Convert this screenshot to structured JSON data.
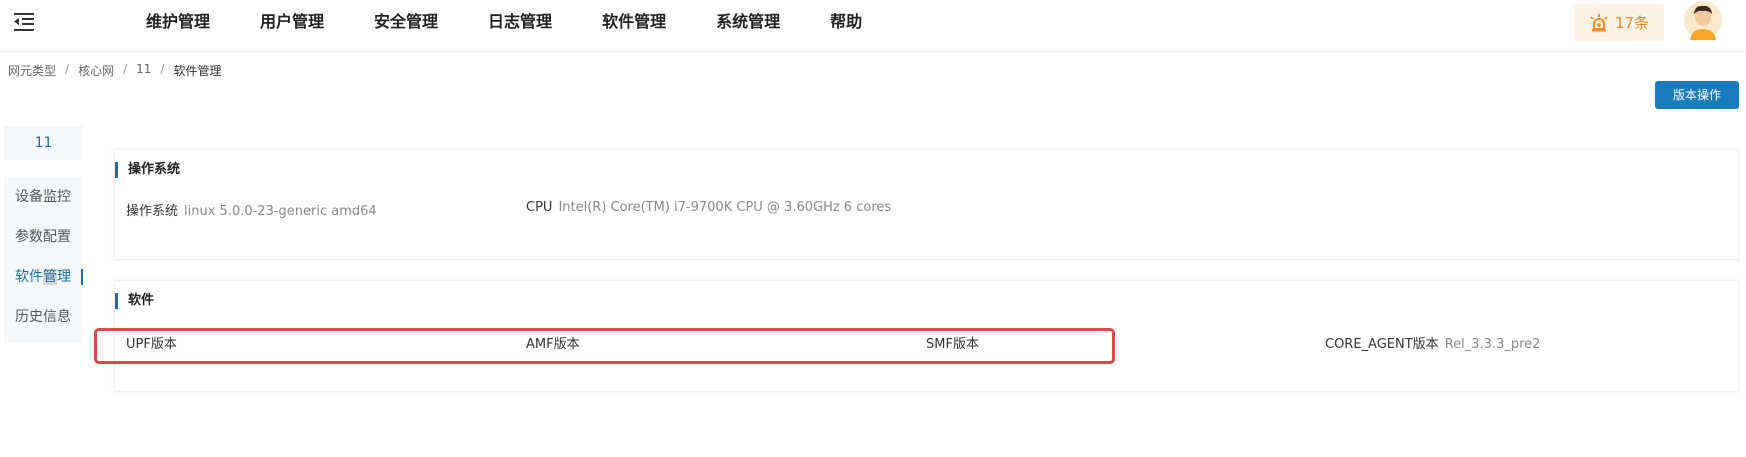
{
  "nav": {
    "items": [
      "维护管理",
      "用户管理",
      "安全管理",
      "日志管理",
      "软件管理",
      "系统管理",
      "帮助"
    ]
  },
  "alarm": {
    "count_label": "17条"
  },
  "breadcrumb": [
    "网元类型",
    "核心网",
    "11",
    "软件管理"
  ],
  "toolbar": {
    "version_op_label": "版本操作"
  },
  "sidebar": {
    "ne_name": "11",
    "items": [
      {
        "label": "设备监控"
      },
      {
        "label_a": "软件",
        "label_hl": "管",
        "label_b": "理"
      },
      {
        "label": "历史信息"
      }
    ],
    "param_label": "参数配置"
  },
  "os_card": {
    "title": "操作系统",
    "os_label": "操作系统",
    "os_value": "linux 5.0.0-23-generic amd64",
    "cpu_label": "CPU",
    "cpu_value": "Intel(R) Core(TM) i7-9700K CPU @ 3.60GHz 6 cores"
  },
  "software_card": {
    "title": "软件",
    "upf_label": "UPF版本",
    "amf_label": "AMF版本",
    "smf_label": "SMF版本",
    "core_agent_label": "CORE_AGENT版本",
    "core_agent_value": "Rel_3.3.3_pre2"
  },
  "colors": {
    "accent": "#1a7bbd",
    "alarm": "#f28b2c",
    "highlight_box": "#e04848"
  }
}
